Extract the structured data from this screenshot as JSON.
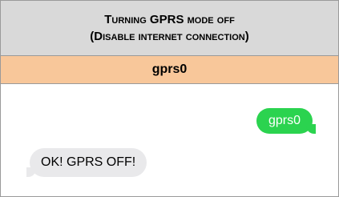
{
  "header": {
    "line1_prefix": "T",
    "line1_rest": "urning",
    "line1_mid": " GPRS ",
    "line1_suffix": "mode off",
    "line2_open": "(",
    "line2_prefix": "D",
    "line2_rest": "isable internet connection",
    "line2_close": ")"
  },
  "command": {
    "label": "gprs0"
  },
  "chat": {
    "outgoing": "gprs0",
    "incoming": "OK! GPRS OFF!"
  },
  "colors": {
    "header_bg": "#d9d9d9",
    "command_bg": "#f8c79a",
    "outgoing_bubble": "#2bd34f",
    "incoming_bubble": "#e9e9eb"
  }
}
